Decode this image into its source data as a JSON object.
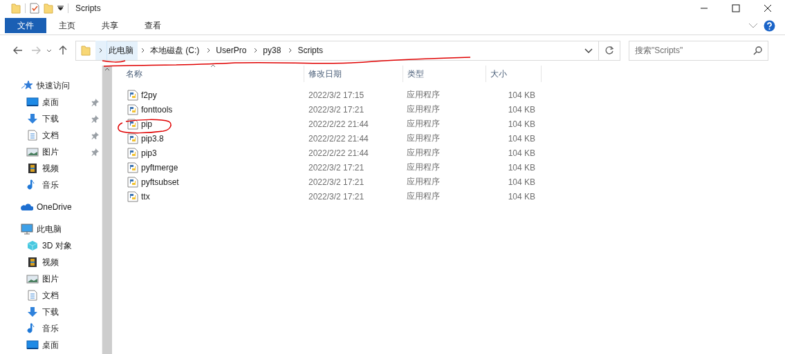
{
  "window": {
    "title": "Scripts"
  },
  "ribbon_tabs": [
    {
      "label": "文件",
      "selected": true
    },
    {
      "label": "主页",
      "selected": false
    },
    {
      "label": "共享",
      "selected": false
    },
    {
      "label": "查看",
      "selected": false
    }
  ],
  "breadcrumb": [
    {
      "label": "此电脑",
      "selected": true
    },
    {
      "label": "本地磁盘 (C:)",
      "selected": false
    },
    {
      "label": "UserPro",
      "selected": false
    },
    {
      "label": "py38",
      "selected": false
    },
    {
      "label": "Scripts",
      "selected": false
    }
  ],
  "search": {
    "placeholder": "搜索\"Scripts\""
  },
  "sidebar": {
    "groups": [
      {
        "label": "快速访问",
        "kind": "star",
        "children": [
          {
            "label": "桌面",
            "kind": "desktop",
            "pinned": true
          },
          {
            "label": "下载",
            "kind": "download",
            "pinned": true
          },
          {
            "label": "文档",
            "kind": "document",
            "pinned": true
          },
          {
            "label": "图片",
            "kind": "pictures",
            "pinned": true
          },
          {
            "label": "视频",
            "kind": "video",
            "pinned": false
          },
          {
            "label": "音乐",
            "kind": "music",
            "pinned": false
          }
        ]
      },
      {
        "label": "OneDrive",
        "kind": "cloud"
      },
      {
        "label": "此电脑",
        "kind": "pc",
        "children": [
          {
            "label": "3D 对象",
            "kind": "cube",
            "pinned": false
          },
          {
            "label": "视频",
            "kind": "video",
            "pinned": false
          },
          {
            "label": "图片",
            "kind": "pictures",
            "pinned": false
          },
          {
            "label": "文档",
            "kind": "document",
            "pinned": false
          },
          {
            "label": "下载",
            "kind": "download",
            "pinned": false
          },
          {
            "label": "音乐",
            "kind": "music",
            "pinned": false
          },
          {
            "label": "桌面",
            "kind": "desktop",
            "pinned": false
          }
        ]
      }
    ]
  },
  "table": {
    "columns": [
      "名称",
      "修改日期",
      "类型",
      "大小"
    ],
    "rows": [
      {
        "name": "f2py",
        "date": "2022/3/2 17:15",
        "type": "应用程序",
        "size": "104 KB"
      },
      {
        "name": "fonttools",
        "date": "2022/3/2 17:21",
        "type": "应用程序",
        "size": "104 KB"
      },
      {
        "name": "pip",
        "date": "2022/2/22 21:44",
        "type": "应用程序",
        "size": "104 KB"
      },
      {
        "name": "pip3.8",
        "date": "2022/2/22 21:44",
        "type": "应用程序",
        "size": "104 KB"
      },
      {
        "name": "pip3",
        "date": "2022/2/22 21:44",
        "type": "应用程序",
        "size": "104 KB"
      },
      {
        "name": "pyftmerge",
        "date": "2022/3/2 17:21",
        "type": "应用程序",
        "size": "104 KB"
      },
      {
        "name": "pyftsubset",
        "date": "2022/3/2 17:21",
        "type": "应用程序",
        "size": "104 KB"
      },
      {
        "name": "ttx",
        "date": "2022/3/2 17:21",
        "type": "应用程序",
        "size": "104 KB"
      }
    ]
  }
}
